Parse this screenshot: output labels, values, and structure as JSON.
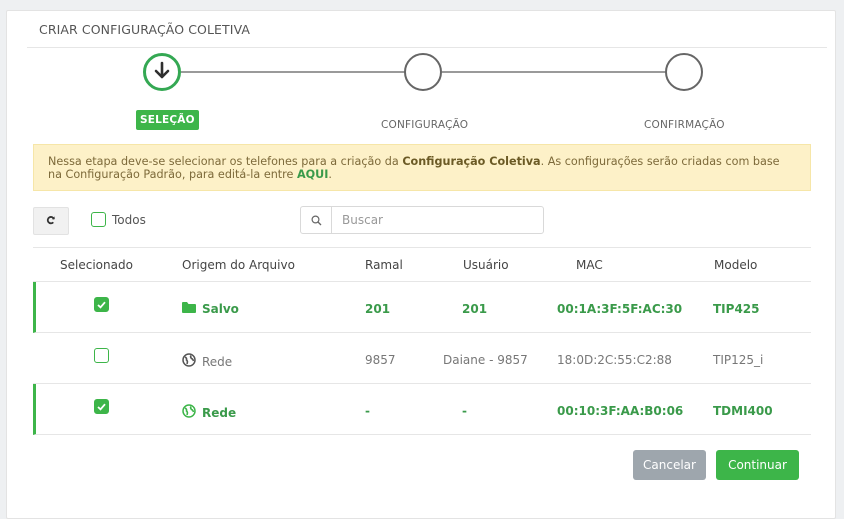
{
  "modal": {
    "title": "CRIAR CONFIGURAÇÃO COLETIVA"
  },
  "steps": [
    {
      "label": "SELEÇÃO",
      "active": true
    },
    {
      "label": "CONFIGURAÇÃO",
      "active": false
    },
    {
      "label": "CONFIRMAÇÃO",
      "active": false
    }
  ],
  "alert": {
    "text_1": "Nessa etapa deve-se selecionar os telefones para a criação da ",
    "bold": "Configuração Coletiva",
    "text_2": ". As configurações serão criadas com base na Configuração Padrão, para editá-la entre ",
    "link": "AQUI",
    "text_3": "."
  },
  "toolbar": {
    "select_all_label": "Todos",
    "search_placeholder": "Buscar"
  },
  "table": {
    "headers": [
      "Selecionado",
      "Origem do Arquivo",
      "Ramal",
      "Usuário",
      "MAC",
      "Modelo"
    ],
    "rows": [
      {
        "selected": true,
        "origin_icon": "folder-icon",
        "origin": "Salvo",
        "ramal": "201",
        "usuario": "201",
        "mac": "00:1A:3F:5F:AC:30",
        "modelo": "TIP425"
      },
      {
        "selected": false,
        "origin_icon": "globe-icon",
        "origin": "Rede",
        "ramal": "9857",
        "usuario": "Daiane - 9857",
        "mac": "18:0D:2C:55:C2:88",
        "modelo": "TIP125_i"
      },
      {
        "selected": true,
        "origin_icon": "globe-icon",
        "origin": "Rede",
        "ramal": "-",
        "usuario": "-",
        "mac": "00:10:3F:AA:B0:06",
        "modelo": "TDMI400"
      }
    ]
  },
  "footer": {
    "cancel_label": "Cancelar",
    "continue_label": "Continuar"
  },
  "colors": {
    "accent": "#3db549",
    "alert_bg": "#fdf1c8",
    "cancel": "#9ea6ad"
  }
}
